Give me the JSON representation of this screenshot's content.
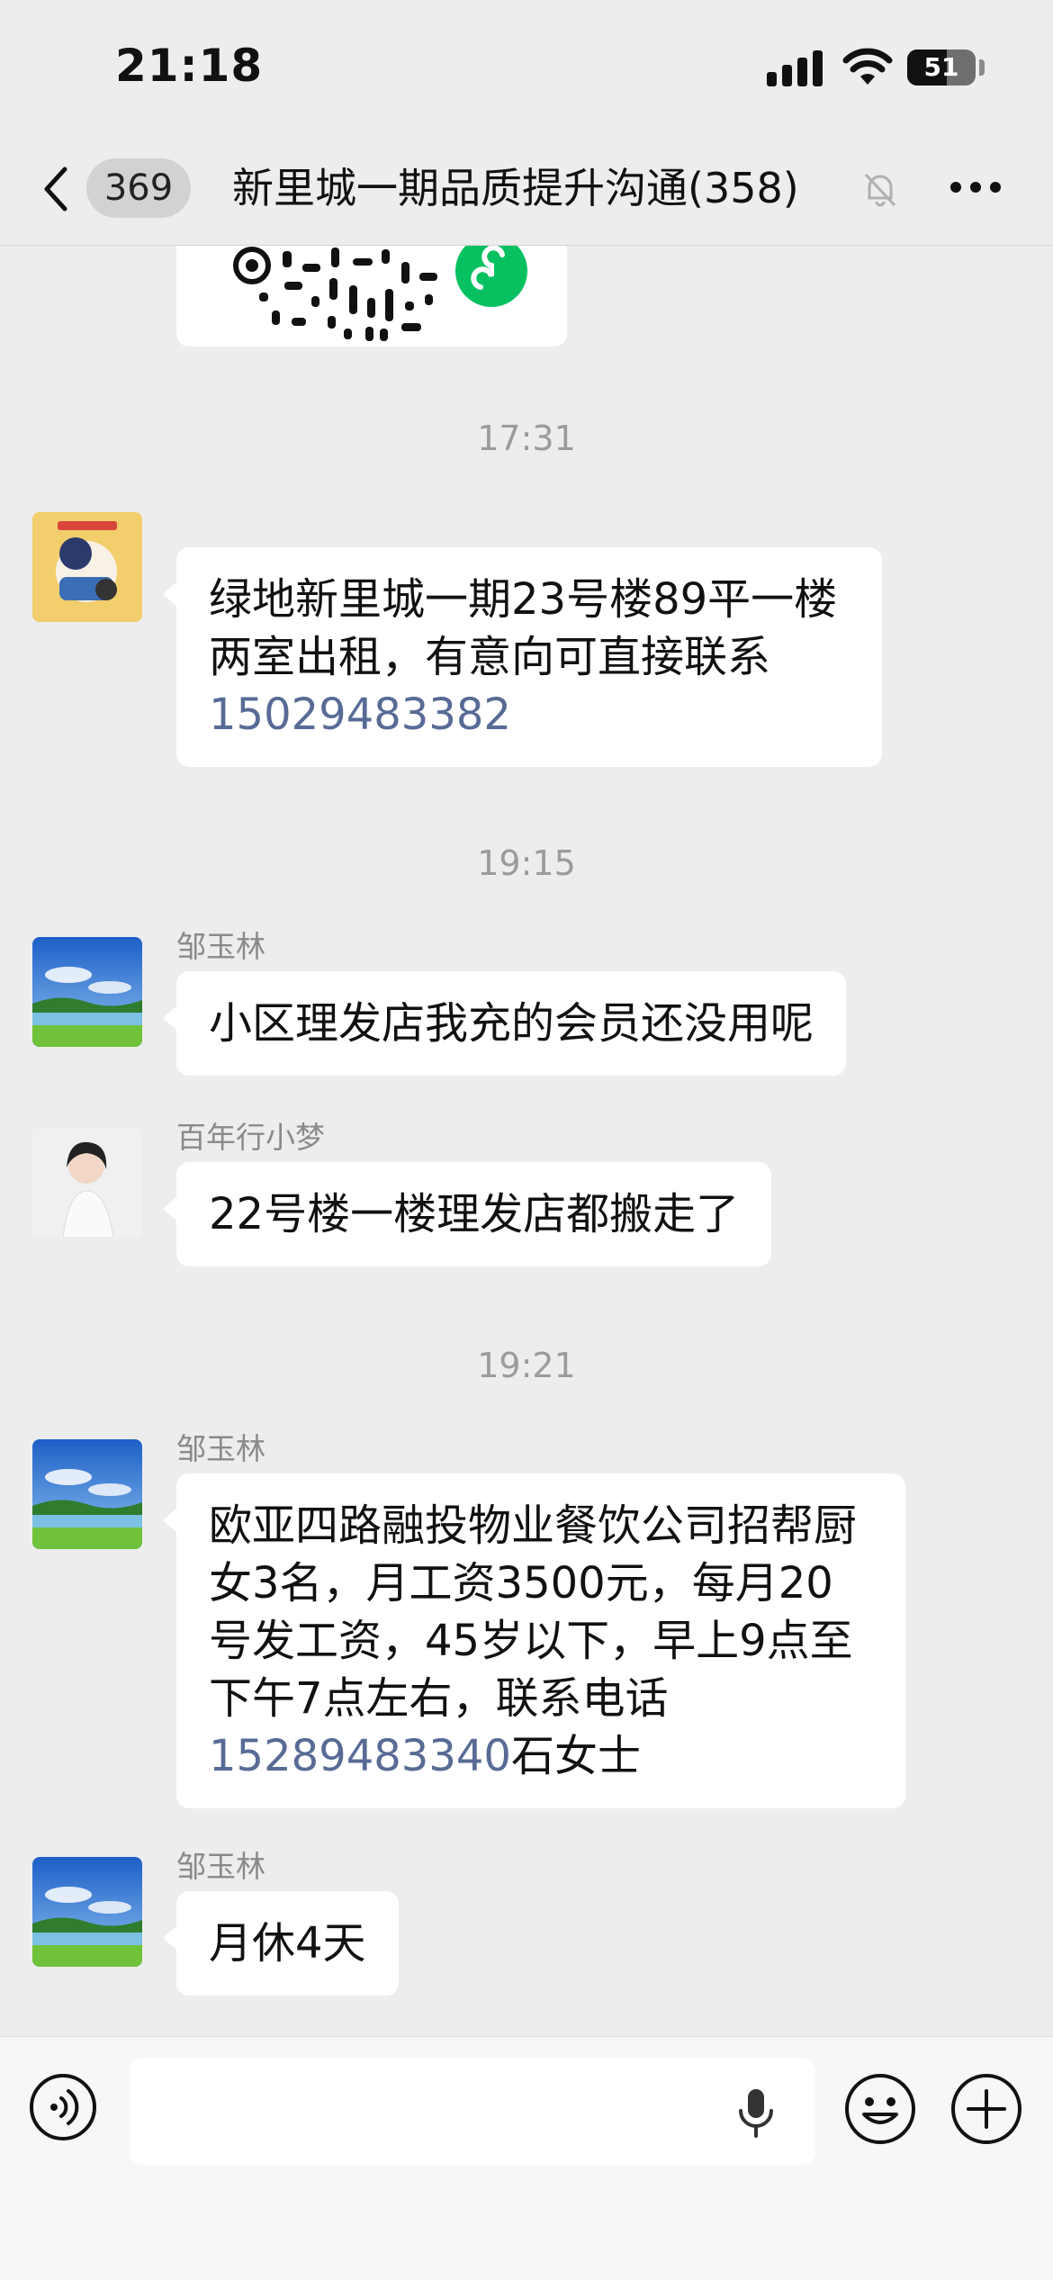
{
  "status_bar": {
    "time": "21:18",
    "battery_level": "51"
  },
  "header": {
    "back_count": "369",
    "title": "新里城一期品质提升沟通(358)"
  },
  "messages": [
    {
      "time": "17:31",
      "sender": "",
      "text": "绿地新里城一期23号楼89平一楼两室出租，有意向可直接联系",
      "phone": "15029483382",
      "suffix": ""
    },
    {
      "time": "19:15",
      "sender": "邹玉林",
      "text": "小区理发店我充的会员还没用呢"
    },
    {
      "sender": "百年行小梦",
      "text": "22号楼一楼理发店都搬走了"
    },
    {
      "time": "19:21",
      "sender": "邹玉林",
      "text": "欧亚四路融投物业餐饮公司招帮厨女3名，月工资3500元，每月20号发工资，45岁以下，早上9点至下午7点左右，联系电话",
      "phone": "15289483340",
      "suffix": "石女士"
    },
    {
      "sender": "邹玉林",
      "text": "月休4天"
    }
  ],
  "colors": {
    "link": "#576b95",
    "chat_bg": "#ededed",
    "bubble": "#ffffff",
    "miniprogram": "#07c160"
  },
  "icons": [
    "back-icon",
    "mute-bell-icon",
    "more-icon",
    "voice-icon",
    "mic-icon",
    "emoji-icon",
    "plus-icon"
  ]
}
